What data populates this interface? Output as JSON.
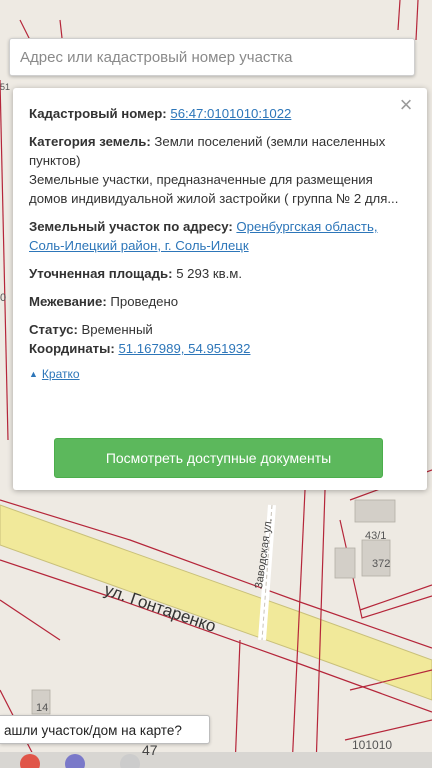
{
  "search": {
    "placeholder": "Адрес или кадастровый номер участка"
  },
  "card": {
    "cadastral_label": "Кадастровый номер:",
    "cadastral_value": "56:47:0101010:1022",
    "category_label": "Категория земель:",
    "category_value": "Земли поселений (земли населенных пунктов)",
    "usage_text": "Земельные участки, предназначенные для размещения домов индивидуальной жилой застройки ( группа № 2 для...",
    "address_label": "Земельный участок по адресу:",
    "address_value": "Оренбургская область, Соль-Илецкий район, г. Соль-Илецк",
    "area_label": "Уточненная площадь:",
    "area_value": "5 293 кв.м.",
    "survey_label": "Межевание:",
    "survey_value": "Проведено",
    "status_label": "Статус:",
    "status_value": "Временный",
    "coords_label": "Координаты:",
    "coords_value": "51.167989, 54.951932",
    "collapse_label": "Кратко",
    "docs_button": "Посмотреть доступные документы",
    "close_icon": "close-icon"
  },
  "map": {
    "street_main": "ул. Гонтаренко",
    "street_side": "Заводская ул.",
    "plot_43_1": "43/1",
    "plot_372": "372",
    "plot_14": "14",
    "plot_47": "47",
    "plot_101010": "101010",
    "edge_51": "51",
    "edge_0": "0",
    "found_prompt": "ашли участок/дом на карте?"
  },
  "colors": {
    "link": "#2d76b9",
    "button": "#5cb85c",
    "boundary": "#b5263a",
    "road": "#f1e99a"
  }
}
